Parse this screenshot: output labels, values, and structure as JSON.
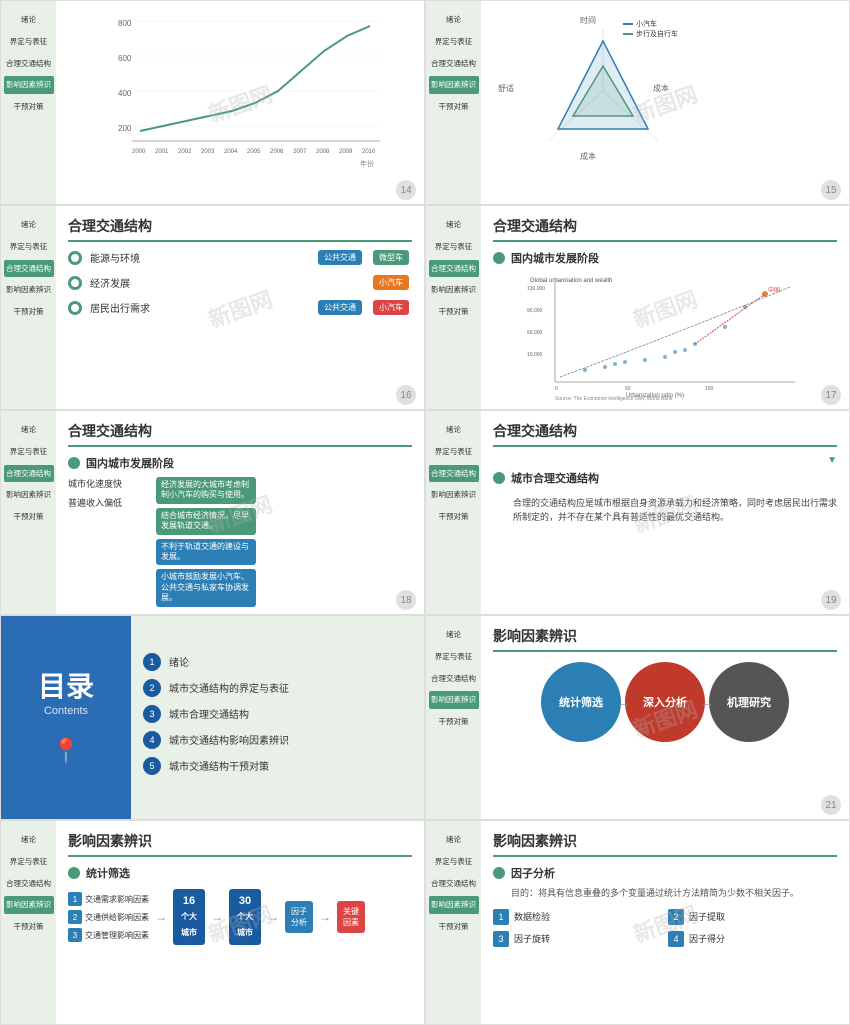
{
  "slides": [
    {
      "id": 14,
      "title": "",
      "sidebar": [
        "绪论",
        "界定与表征",
        "合理交通结构",
        "影响因素辨识",
        "干预对策"
      ],
      "active": 3
    },
    {
      "id": 15,
      "title": "",
      "sidebar": [
        "绪论",
        "界定与表征",
        "合理交通结构",
        "影响因素辨识",
        "干预对策"
      ],
      "active": 3
    },
    {
      "id": 16,
      "title": "合理交通结构",
      "sidebar": [
        "绪论",
        "界定与表征",
        "合理交通结构",
        "影响因素辨识",
        "干预对策"
      ],
      "active": 2,
      "rows": [
        {
          "label": "能源与环境",
          "tags": [
            {
              "text": "公共交通",
              "color": "blue"
            },
            {
              "text": "微型车",
              "color": "green"
            }
          ]
        },
        {
          "label": "经济发展",
          "tags": [
            {
              "text": "小汽车",
              "color": "orange"
            }
          ]
        },
        {
          "label": "居民出行需求",
          "tags": [
            {
              "text": "公共交通",
              "color": "blue"
            },
            {
              "text": "小汽车",
              "color": "red"
            }
          ]
        }
      ]
    },
    {
      "id": 17,
      "title": "合理交通结构",
      "sidebar": [
        "绪论",
        "界定与表征",
        "合理交通结构",
        "影响因素辨识",
        "干预对策"
      ],
      "active": 2,
      "sub_title": "国内城市发展阶段",
      "chart_label": "Global urbanisation and wealth",
      "china_label": "中国"
    },
    {
      "id": 18,
      "title": "合理交通结构",
      "sidebar": [
        "绪论",
        "界定与表征",
        "合理交通结构",
        "影响因素辨识",
        "干预对策"
      ],
      "active": 2,
      "sub_title": "国内城市发展阶段",
      "items": [
        "城市化速度快",
        "普遍收入偏低"
      ],
      "bubbles": [
        "经济发展的大城市考虑制制小汽车的购买与使用。",
        "结合城市经济情况，尽早发展轨道交通。",
        "不利于轨道交通的建设与发展。",
        "小城市鼓励发展小汽车、公共交通与私家车协调发展。"
      ]
    },
    {
      "id": 19,
      "title": "合理交通结构",
      "sidebar": [
        "绪论",
        "界定与表征",
        "合理交通结构",
        "影响因素辨识",
        "干预对策"
      ],
      "active": 2,
      "sub_title": "城市合理交通结构",
      "desc": "合理的交通结构应是城市根据自身资源承载力和经济策略，同时考虑居民出行需求所制定的，并不存在某个具有普适性的最优交通结构。"
    },
    {
      "id": 20,
      "title": "目录",
      "sub": "Contents",
      "items": [
        {
          "num": 1,
          "text": "绪论"
        },
        {
          "num": 2,
          "text": "城市交通结构的界定与表征"
        },
        {
          "num": 3,
          "text": "城市合理交通结构"
        },
        {
          "num": 4,
          "text": "城市交通结构影响因素辨识"
        },
        {
          "num": 5,
          "text": "城市交通结构干预对策"
        }
      ]
    },
    {
      "id": 21,
      "title": "影响因素辨识",
      "sidebar": [
        "绪论",
        "界定与表征",
        "合理交通结构",
        "影响因素辨识",
        "干预对策"
      ],
      "active": 3,
      "circles": [
        {
          "label": "统计筛选",
          "color": "blue"
        },
        {
          "label": "深入分析",
          "color": "red"
        },
        {
          "label": "机理研究",
          "color": "gray"
        }
      ]
    },
    {
      "id": 22,
      "title": "影响因素辨识",
      "sidebar": [
        "绪论",
        "界定与表征",
        "合理交通结构",
        "影响因素辨识",
        "干预对策"
      ],
      "active": 3,
      "sub_title": "统计筛选",
      "factors": [
        "交通需求影响因素",
        "交通供给影响因素",
        "交通管理影响因素"
      ],
      "mid_num": "16\n个大\n城市",
      "mid_num2": "30\n个大\n城市",
      "step_label": "因子\n分析",
      "result_label": "关键\n因素"
    },
    {
      "id": 23,
      "title": "影响因素辨识",
      "sidebar": [
        "绪论",
        "界定与表征",
        "合理交通结构",
        "影响因素辨识",
        "干预对策"
      ],
      "active": 3,
      "sub_title": "因子分析",
      "desc": "目的：将具有信息重叠的多个变量通过统计方法精简为少数不相关因子。",
      "grid_items": [
        {
          "num": 1,
          "text": "数据检验"
        },
        {
          "num": 2,
          "text": "因子提取"
        },
        {
          "num": 3,
          "text": "因子旋转"
        },
        {
          "num": 4,
          "text": "因子得分"
        }
      ]
    }
  ],
  "sidebar_labels": {
    "s1": "绪论",
    "s2": "界定与表征",
    "s3": "合理交通结构",
    "s4": "影响因素辨识",
    "s5": "干预对策"
  },
  "watermark": "新图网",
  "colors": {
    "green": "#4a9a7a",
    "blue": "#2b7fb5",
    "darkblue": "#2a6db5",
    "red": "#d44444",
    "orange": "#e87722",
    "gray": "#555555"
  }
}
